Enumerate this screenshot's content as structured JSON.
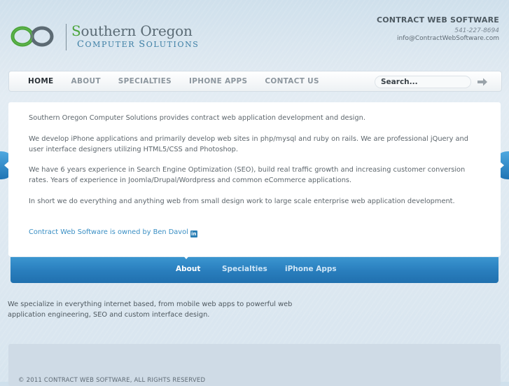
{
  "header": {
    "logo": {
      "line1_first": "S",
      "line1_rest": "outhern Oregon",
      "line2_parts": [
        "C",
        "OMPUTER ",
        "S",
        "OLUTIONS"
      ]
    },
    "contact": {
      "title": "CONTRACT WEB SOFTWARE",
      "phone": "541-227-8694",
      "email": "info@ContractWebSoftware.com"
    }
  },
  "nav": {
    "items": [
      {
        "label": "HOME",
        "active": true
      },
      {
        "label": "ABOUT",
        "active": false
      },
      {
        "label": "SPECIALTIES",
        "active": false
      },
      {
        "label": "IPHONE APPS",
        "active": false
      },
      {
        "label": "CONTACT US",
        "active": false
      }
    ],
    "search": {
      "placeholder": "Search...",
      "value": ""
    }
  },
  "panel": {
    "paragraphs": [
      "Southern Oregon Computer Solutions provides contract web application development and design.",
      "We develop iPhone applications and primarily develop web sites in php/mysql and ruby on rails. We are professional jQuery and user interface designers utilizing HTML5/CSS and Photoshop.",
      "We have 6 years experience in Search Engine Optimization (SEO), build real traffic growth and increasing customer conversion rates. Years of experience in Joomla/Drupal/Wordpress and common eCommerce applications.",
      "In short we do everything and anything web from small design work to large scale enterprise web application development."
    ],
    "owner": "Contract Web Software is owned by Ben Davol",
    "owner_icon_label": "in"
  },
  "tabs": [
    {
      "label": "About",
      "active": true
    },
    {
      "label": "Specialties",
      "active": false
    },
    {
      "label": "iPhone Apps",
      "active": false
    }
  ],
  "intro": "We specialize in everything internet based, from mobile web apps to powerful web application engineering, SEO and custom interface design.",
  "footer": {
    "copyright": "© 2011 CONTRACT WEB SOFTWARE, ALL RIGHTS RESERVED"
  },
  "colors": {
    "accent_blue": "#2a7fbe",
    "logo_green": "#4aa43a",
    "link_blue": "#3a8fc4"
  },
  "icons": {
    "search_button": "arrow-right-icon",
    "slider_prev": "chevron-left-icon",
    "slider_next": "chevron-right-icon",
    "owner_social": "linkedin-icon"
  }
}
